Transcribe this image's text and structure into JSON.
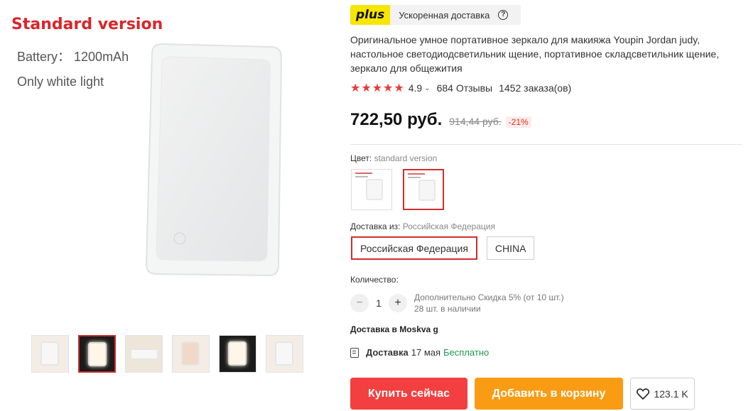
{
  "gallery": {
    "main_image": {
      "title": "Standard version",
      "line1": "Battery： 1200mAh",
      "line2": "Only white light"
    },
    "thumbnails": [
      "thumb-1",
      "thumb-2",
      "thumb-3",
      "thumb-4",
      "thumb-5",
      "thumb-6"
    ],
    "selected_thumbnail": 2
  },
  "plus": {
    "logo": "plus",
    "text": "Ускоренная доставка",
    "help": "?"
  },
  "product": {
    "title": "Оригинальное умное портативное зеркало для макияжа Youpin Jordan judy, настольное светодиодсветильник щение, портативное складсветильник щение, зеркало для общежития",
    "rating": "4.9",
    "reviews": "684 Отзывы",
    "orders": "1452 заказа(ов)",
    "price": "722,50 руб.",
    "old_price": "914,44 руб.",
    "discount": "-21%"
  },
  "color": {
    "label": "Цвет:",
    "value": "standard version"
  },
  "shipping": {
    "label": "Доставка из:",
    "value": "Российская Федерация",
    "options": [
      "Российская Федерация",
      "CHINA"
    ]
  },
  "quantity": {
    "label": "Количество:",
    "value": "1",
    "minus": "−",
    "plus": "+",
    "discount_note": "Дополнительно Скидка 5% (от 10 шт.)",
    "stock": "28 шт. в наличии"
  },
  "delivery": {
    "to": "Доставка в Moskva g",
    "label": "Доставка",
    "date": "17 мая",
    "cost": "Бесплатно"
  },
  "actions": {
    "buy": "Купить сейчас",
    "cart": "Добавить в корзину",
    "wishlist_count": "123.1 K"
  },
  "colors": {
    "accent_red": "#f33f3f",
    "cart_orange": "#fa9b14",
    "plus_yellow": "#f7e600",
    "free_green": "#1e9850",
    "star_red": "#ea3b3b"
  }
}
